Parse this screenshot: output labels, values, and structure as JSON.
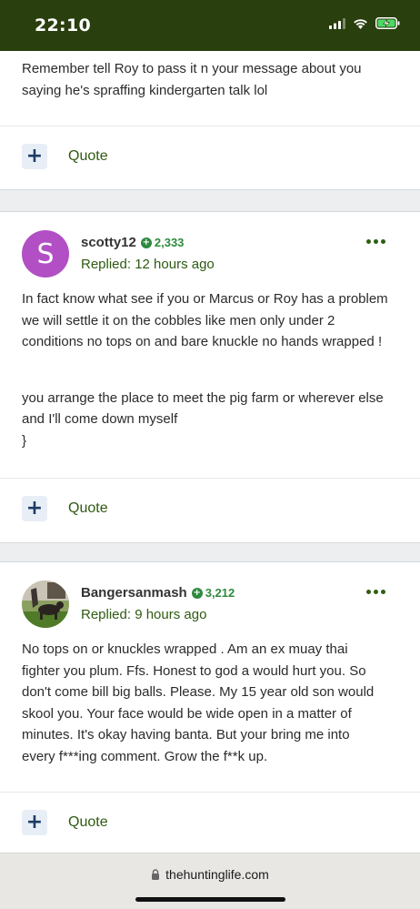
{
  "status_bar": {
    "time": "22:10"
  },
  "posts": [
    {
      "text": [
        "Remember tell Roy to pass it n your message about you saying he's spraffing kindergarten talk lol"
      ],
      "quote_label": "Quote"
    },
    {
      "author": "scotty12",
      "avatar_letter": "S",
      "reputation": "2,333",
      "replied": "Replied: 12 hours ago",
      "text": [
        "In fact know what see if you or Marcus or Roy has a problem we will settle it on the cobbles like men only under 2 conditions no tops on and bare knuckle no hands wrapped !",
        "you arrange the place to meet the pig farm or wherever else and I'll come down myself"
      ],
      "quote_label": "Quote"
    },
    {
      "author": "Bangersanmash",
      "reputation": "3,212",
      "replied": "Replied: 9 hours ago",
      "text": [
        "No tops on or knuckles wrapped . Am an ex muay thai fighter you plum. Ffs. Honest to god a would hurt you. So don't come bill big balls. Please. My 15 year old son would skool you. Your face would be wide open in a matter of minutes. It's okay having banta. But your bring me into every f***ing comment. Grow the f**k up."
      ],
      "quote_label": "Quote"
    }
  ],
  "browser": {
    "url": "thehuntinglife.com"
  },
  "colors": {
    "status_bar": "#2a3f0e",
    "accent_green": "#2e5a12",
    "reputation_green": "#2e8a3e",
    "avatar_purple": "#b24fc4"
  }
}
